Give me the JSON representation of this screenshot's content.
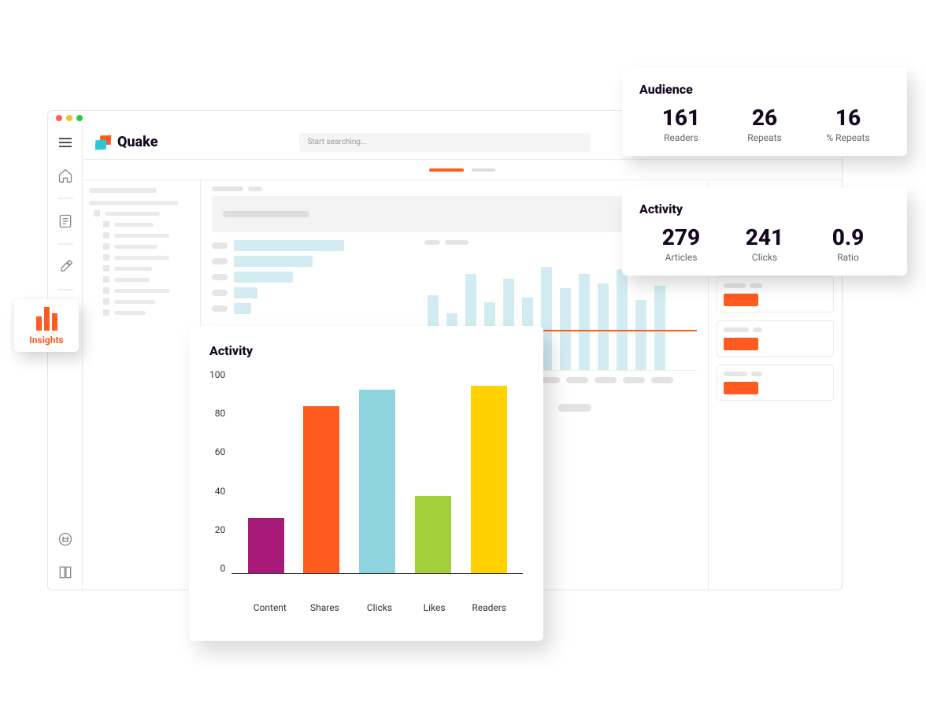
{
  "app": {
    "name": "Quake"
  },
  "search": {
    "placeholder": "Start searching..."
  },
  "sidebar_popout": {
    "label": "Insights"
  },
  "cards": {
    "audience": {
      "title": "Audience",
      "stats": [
        {
          "value": "161",
          "label": "Readers"
        },
        {
          "value": "26",
          "label": "Repeats"
        },
        {
          "value": "16",
          "label": "% Repeats"
        }
      ]
    },
    "activity": {
      "title": "Activity",
      "stats": [
        {
          "value": "279",
          "label": "Articles"
        },
        {
          "value": "241",
          "label": "Clicks"
        },
        {
          "value": "0.9",
          "label": "Ratio"
        }
      ]
    }
  },
  "chart_data": {
    "type": "bar",
    "title": "Activity",
    "categories": [
      "Content",
      "Shares",
      "Clicks",
      "Likes",
      "Readers"
    ],
    "values": [
      27,
      82,
      90,
      38,
      92
    ],
    "ylim": [
      0,
      100
    ],
    "yticks": [
      0,
      20,
      40,
      60,
      80,
      100
    ],
    "colors": [
      "#a81a78",
      "#ff5a1f",
      "#8fd3df",
      "#a3cf3c",
      "#ffd100"
    ]
  }
}
